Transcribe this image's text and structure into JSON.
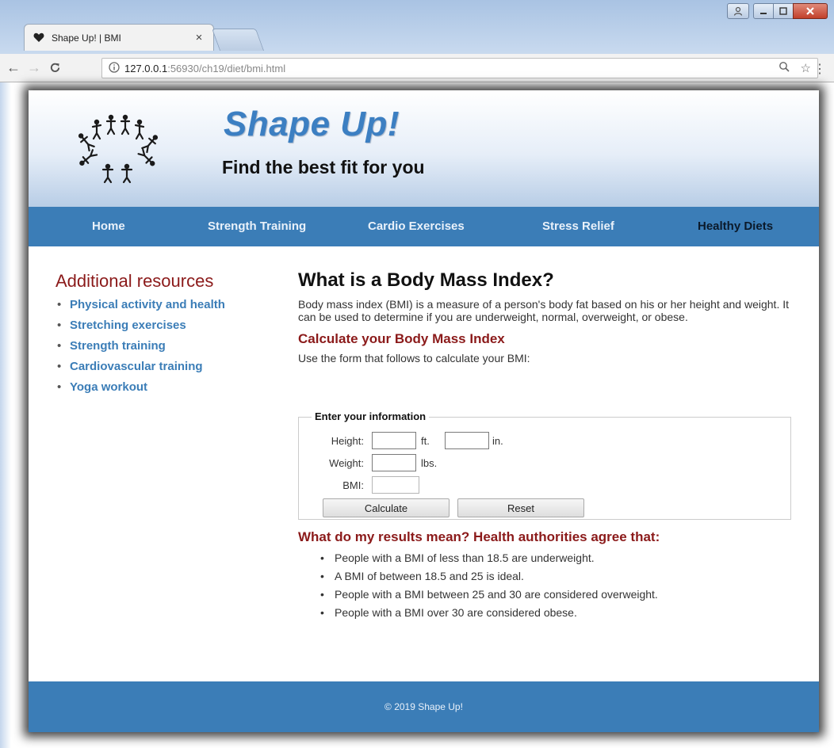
{
  "browser": {
    "tab_title": "Shape Up! | BMI",
    "url_host": "127.0.0.1",
    "url_path": ":56930/ch19/diet/bmi.html"
  },
  "site": {
    "title": "Shape Up!",
    "tagline": "Find the best fit for you"
  },
  "nav": [
    {
      "label": "Home",
      "active": false
    },
    {
      "label": "Strength Training",
      "active": false
    },
    {
      "label": "Cardio Exercises",
      "active": false
    },
    {
      "label": "Stress Relief",
      "active": false
    },
    {
      "label": "Healthy Diets",
      "active": true
    }
  ],
  "sidebar": {
    "heading": "Additional resources",
    "links": [
      "Physical activity and health",
      "Stretching exercises",
      "Strength training",
      "Cardiovascular training",
      "Yoga workout"
    ]
  },
  "main": {
    "title": "What is a Body Mass Index?",
    "intro": "Body mass index (BMI) is a measure of a person's body fat based on his or her height and weight. It can be used to determine if you are underweight, normal, overweight, or obese.",
    "calc_heading": "Calculate your Body Mass Index",
    "instructions": "Use the form that follows to calculate your BMI:"
  },
  "form": {
    "legend": "Enter your information",
    "height_label": "Height:",
    "feet_unit": "ft.",
    "inches_unit": "in.",
    "weight_label": "Weight:",
    "weight_unit": "lbs.",
    "bmi_label": "BMI:",
    "height_ft_value": "",
    "height_in_value": "",
    "weight_value": "",
    "bmi_value": "",
    "calculate_label": "Calculate",
    "reset_label": "Reset"
  },
  "results": {
    "heading": "What do my results mean? Health authorities agree that:",
    "items": [
      "People with a BMI of less than 18.5 are underweight.",
      "A BMI of between 18.5 and 25 is ideal.",
      "People with a BMI between 25 and 30 are considered overweight.",
      "People with a BMI over 30 are considered obese."
    ]
  },
  "footer": {
    "text": "© 2019 Shape Up!"
  },
  "colors": {
    "brand_blue": "#3b7db7",
    "heading_red": "#8b1a1a",
    "title_blue": "#3c7fc2"
  }
}
